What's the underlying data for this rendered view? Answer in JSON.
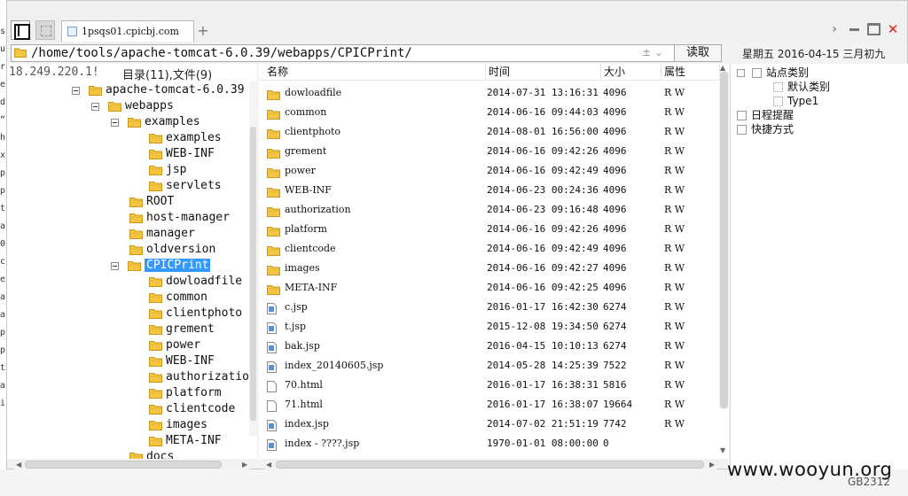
{
  "tab": {
    "label": "1psqs01.cpicbj.com"
  },
  "address": {
    "path": "/home/tools/apache-tomcat-6.0.39/webapps/CPICPrint/",
    "control_text": "± ⌄",
    "read_label": "读取"
  },
  "date": {
    "text": "星期五 2016-04-15 三月初九"
  },
  "tree_header": {
    "ip": "18.249.220.1!",
    "counts": "目录(11),文件(9)"
  },
  "tree": [
    {
      "label": "apache-tomcat-6.0.39",
      "depth": 0,
      "expanded": true,
      "selected": false
    },
    {
      "label": "webapps",
      "depth": 1,
      "expanded": true,
      "selected": false
    },
    {
      "label": "examples",
      "depth": 2,
      "expanded": true,
      "selected": false
    },
    {
      "label": "examples",
      "depth": 3,
      "expanded": false,
      "selected": false
    },
    {
      "label": "WEB-INF",
      "depth": 3,
      "expanded": false,
      "selected": false
    },
    {
      "label": "jsp",
      "depth": 3,
      "expanded": false,
      "selected": false
    },
    {
      "label": "servlets",
      "depth": 3,
      "expanded": false,
      "selected": false
    },
    {
      "label": "ROOT",
      "depth": 2,
      "expanded": false,
      "selected": false
    },
    {
      "label": "host-manager",
      "depth": 2,
      "expanded": false,
      "selected": false
    },
    {
      "label": "manager",
      "depth": 2,
      "expanded": false,
      "selected": false
    },
    {
      "label": "oldversion",
      "depth": 2,
      "expanded": false,
      "selected": false
    },
    {
      "label": "CPICPrint",
      "depth": 2,
      "expanded": true,
      "selected": true
    },
    {
      "label": "dowloadfile",
      "depth": 3,
      "expanded": false,
      "selected": false
    },
    {
      "label": "common",
      "depth": 3,
      "expanded": false,
      "selected": false
    },
    {
      "label": "clientphoto",
      "depth": 3,
      "expanded": false,
      "selected": false
    },
    {
      "label": "grement",
      "depth": 3,
      "expanded": false,
      "selected": false
    },
    {
      "label": "power",
      "depth": 3,
      "expanded": false,
      "selected": false
    },
    {
      "label": "WEB-INF",
      "depth": 3,
      "expanded": false,
      "selected": false
    },
    {
      "label": "authorization",
      "depth": 3,
      "expanded": false,
      "selected": false
    },
    {
      "label": "platform",
      "depth": 3,
      "expanded": false,
      "selected": false
    },
    {
      "label": "clientcode",
      "depth": 3,
      "expanded": false,
      "selected": false
    },
    {
      "label": "images",
      "depth": 3,
      "expanded": false,
      "selected": false
    },
    {
      "label": "META-INF",
      "depth": 3,
      "expanded": false,
      "selected": false
    },
    {
      "label": "docs",
      "depth": 2,
      "expanded": false,
      "selected": false
    }
  ],
  "columns": {
    "name": "名称",
    "time": "时间",
    "size": "大小",
    "attr": "属性"
  },
  "files": [
    {
      "name": "dowloadfile",
      "type": "folder",
      "time": "2014-07-31 13:16:31",
      "size": "4096",
      "attr": "R W"
    },
    {
      "name": "common",
      "type": "folder",
      "time": "2014-06-16 09:44:03",
      "size": "4096",
      "attr": "R W"
    },
    {
      "name": "clientphoto",
      "type": "folder",
      "time": "2014-08-01 16:56:00",
      "size": "4096",
      "attr": "R W"
    },
    {
      "name": "grement",
      "type": "folder",
      "time": "2014-06-16 09:42:26",
      "size": "4096",
      "attr": "R W"
    },
    {
      "name": "power",
      "type": "folder",
      "time": "2014-06-16 09:42:49",
      "size": "4096",
      "attr": "R W"
    },
    {
      "name": "WEB-INF",
      "type": "folder",
      "time": "2014-06-23 00:24:36",
      "size": "4096",
      "attr": "R W"
    },
    {
      "name": "authorization",
      "type": "folder",
      "time": "2014-06-23 09:16:48",
      "size": "4096",
      "attr": "R W"
    },
    {
      "name": "platform",
      "type": "folder",
      "time": "2014-06-16 09:42:26",
      "size": "4096",
      "attr": "R W"
    },
    {
      "name": "clientcode",
      "type": "folder",
      "time": "2014-06-16 09:42:49",
      "size": "4096",
      "attr": "R W"
    },
    {
      "name": "images",
      "type": "folder",
      "time": "2014-06-16 09:42:27",
      "size": "4096",
      "attr": "R W"
    },
    {
      "name": "META-INF",
      "type": "folder",
      "time": "2014-06-16 09:42:25",
      "size": "4096",
      "attr": "R W"
    },
    {
      "name": "c.jsp",
      "type": "jsp",
      "time": "2016-01-17 16:42:30",
      "size": "6274",
      "attr": "R W"
    },
    {
      "name": "t.jsp",
      "type": "jsp",
      "time": "2015-12-08 19:34:50",
      "size": "6274",
      "attr": "R W"
    },
    {
      "name": "bak.jsp",
      "type": "jsp",
      "time": "2016-04-15 10:10:13",
      "size": "6274",
      "attr": "R W"
    },
    {
      "name": "index_20140605.jsp",
      "type": "jsp",
      "time": "2014-05-28 14:25:39",
      "size": "7522",
      "attr": "R W"
    },
    {
      "name": "70.html",
      "type": "html",
      "time": "2016-01-17 16:38:31",
      "size": "5816",
      "attr": "R W"
    },
    {
      "name": "71.html",
      "type": "html",
      "time": "2016-01-17 16:38:07",
      "size": "19664",
      "attr": "R W"
    },
    {
      "name": "index.jsp",
      "type": "jsp",
      "time": "2014-07-02 21:51:19",
      "size": "7742",
      "attr": "R W"
    },
    {
      "name": "index - ????.jsp",
      "type": "jsp",
      "time": "1970-01-01 08:00:00",
      "size": "0",
      "attr": ""
    }
  ],
  "right_tree": [
    {
      "label": "站点类别",
      "indent": 0,
      "icon": "expand-square-icon"
    },
    {
      "label": "默认类别",
      "indent": 1,
      "icon": "category-icon"
    },
    {
      "label": "Type1",
      "indent": 1,
      "icon": "category-icon"
    },
    {
      "label": "日程提醒",
      "indent": 0,
      "icon": "reminder-icon"
    },
    {
      "label": "快捷方式",
      "indent": 0,
      "icon": "shortcut-icon"
    }
  ],
  "left_strip_chars": [
    "s",
    "u",
    "r",
    "e",
    "d",
    "“",
    "h",
    "x",
    "p",
    "p",
    "t",
    "a",
    "0",
    "c",
    "e",
    "a",
    "a",
    "p",
    "p",
    "t",
    "a",
    "i"
  ],
  "watermark": "www.wooyun.org",
  "encoding": "GB2312",
  "colors": {
    "selection": "#3399ff",
    "folder": "#f5c542",
    "close": "#dd2222"
  }
}
